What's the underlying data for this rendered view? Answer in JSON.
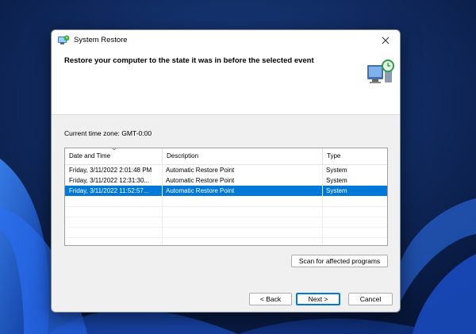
{
  "window": {
    "title": "System Restore",
    "heading": "Restore your computer to the state it was in before the selected event"
  },
  "timezone_label": "Current time zone: GMT-0:00",
  "table": {
    "columns": [
      "Date and Time",
      "Description",
      "Type"
    ],
    "rows": [
      {
        "date": "Friday, 3/11/2022 2:01:48 PM",
        "description": "Automatic Restore Point",
        "type": "System",
        "selected": false
      },
      {
        "date": "Friday, 3/11/2022 12:31:30...",
        "description": "Automatic Restore Point",
        "type": "System",
        "selected": false
      },
      {
        "date": "Friday, 3/11/2022 11:52:57...",
        "description": "Automatic Restore Point",
        "type": "System",
        "selected": true
      }
    ]
  },
  "buttons": {
    "scan": "Scan for affected programs",
    "back": "< Back",
    "next": "Next >",
    "cancel": "Cancel"
  },
  "colors": {
    "selection": "#0078d7",
    "wallpaper": "#0b1e4a"
  },
  "icons": {
    "app": "system-restore-icon",
    "close": "close-icon",
    "header": "computer-restore-icon"
  }
}
